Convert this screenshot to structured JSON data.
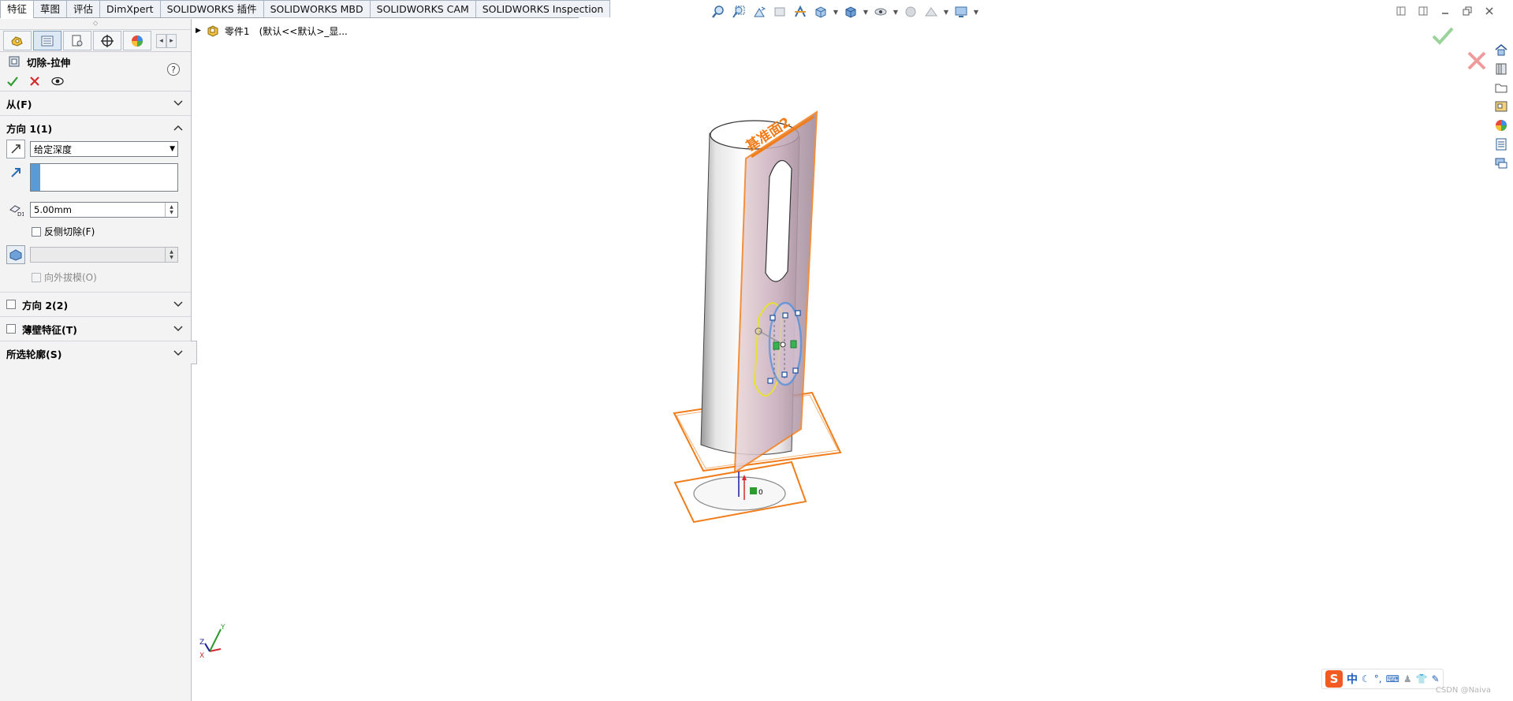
{
  "tabs": [
    {
      "label": "特征",
      "active": true
    },
    {
      "label": "草图",
      "active": false
    },
    {
      "label": "评估",
      "active": false
    },
    {
      "label": "DimXpert",
      "active": false
    },
    {
      "label": "SOLIDWORKS 插件",
      "active": false
    },
    {
      "label": "SOLIDWORKS MBD",
      "active": false
    },
    {
      "label": "SOLIDWORKS CAM",
      "active": false
    },
    {
      "label": "SOLIDWORKS Inspection",
      "active": false
    }
  ],
  "breadcrumb": {
    "part_name": "零件1",
    "config": "(默认<<默认>_显..."
  },
  "property_manager": {
    "feature_title": "切除-拉伸",
    "help": "?",
    "groups": {
      "from": {
        "label": "从(F)"
      },
      "direction1": {
        "label": "方向 1(1)",
        "end_condition": "给定深度",
        "depth": "5.00mm",
        "flip_cut": "反侧切除(F)",
        "draft_outward": "向外拔模(O)"
      },
      "direction2": {
        "label": "方向 2(2)"
      },
      "thin_feature": {
        "label": "薄壁特征(T)"
      },
      "selected_contours": {
        "label": "所选轮廓(S)"
      }
    }
  },
  "viewport": {
    "plane_label_front": "基准面2",
    "triad": {
      "x": "X",
      "y": "Y",
      "z": "Z"
    }
  },
  "ime": {
    "brand": "S",
    "mode": "中"
  },
  "watermark": "CSDN @Naiva",
  "colors": {
    "accent_orange": "#f07d1a",
    "sketch_blue": "#4a90e2",
    "ok_green": "#2e9b2e",
    "cancel_red": "#d12b2b"
  }
}
